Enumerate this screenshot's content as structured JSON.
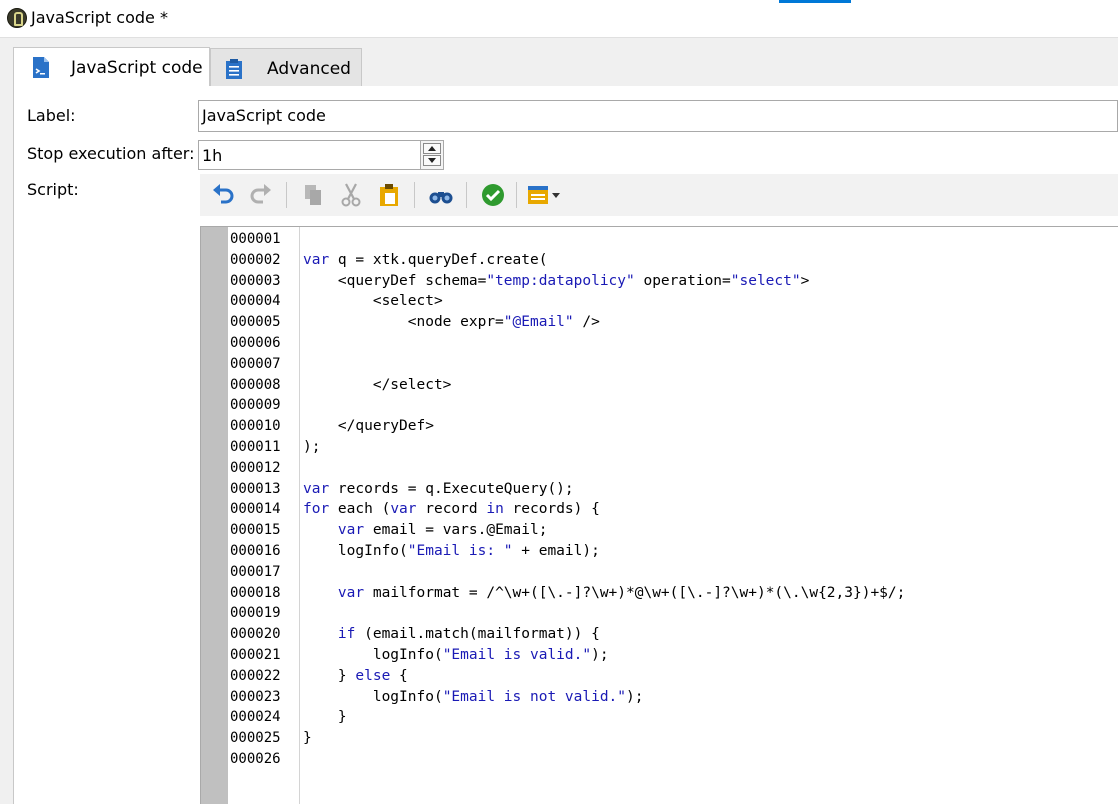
{
  "window": {
    "title": "JavaScript code *"
  },
  "tabs": [
    {
      "label": "JavaScript code",
      "icon": "script-file-icon",
      "active": true
    },
    {
      "label": "Advanced",
      "icon": "clipboard-list-icon",
      "active": false
    }
  ],
  "form": {
    "label_caption": "Label:",
    "label_value": "JavaScript code",
    "stop_caption": "Stop execution after:",
    "stop_value": "1h",
    "script_caption": "Script:"
  },
  "toolbar": [
    "undo-icon",
    "redo-icon",
    "copy-icon",
    "cut-icon",
    "paste-icon",
    "find-icon",
    "validate-icon",
    "insert-menu-icon"
  ],
  "colors": {
    "accent": "#0078d7",
    "keyword": "#1a1ab5",
    "gutter": "#c0c0c0"
  },
  "code_lines": [
    {
      "num": "000001",
      "text": ""
    },
    {
      "num": "000002",
      "text": "var q = xtk.queryDef.create("
    },
    {
      "num": "000003",
      "text": "    <queryDef schema=\"temp:datapolicy\" operation=\"select\">"
    },
    {
      "num": "000004",
      "text": "        <select>"
    },
    {
      "num": "000005",
      "text": "            <node expr=\"@Email\" />"
    },
    {
      "num": "000006",
      "text": ""
    },
    {
      "num": "000007",
      "text": ""
    },
    {
      "num": "000008",
      "text": "        </select>"
    },
    {
      "num": "000009",
      "text": ""
    },
    {
      "num": "000010",
      "text": "    </queryDef>"
    },
    {
      "num": "000011",
      "text": ");"
    },
    {
      "num": "000012",
      "text": ""
    },
    {
      "num": "000013",
      "text": "var records = q.ExecuteQuery();"
    },
    {
      "num": "000014",
      "text": "for each (var record in records) {"
    },
    {
      "num": "000015",
      "text": "    var email = vars.@Email;"
    },
    {
      "num": "000016",
      "text": "    logInfo(\"Email is: \" + email);"
    },
    {
      "num": "000017",
      "text": ""
    },
    {
      "num": "000018",
      "text": "    var mailformat = /^\\w+([\\.-]?\\w+)*@\\w+([\\.-]?\\w+)*(\\.\\w{2,3})+$/;"
    },
    {
      "num": "000019",
      "text": ""
    },
    {
      "num": "000020",
      "text": "    if (email.match(mailformat)) {"
    },
    {
      "num": "000021",
      "text": "        logInfo(\"Email is valid.\");"
    },
    {
      "num": "000022",
      "text": "    } else {"
    },
    {
      "num": "000023",
      "text": "        logInfo(\"Email is not valid.\");"
    },
    {
      "num": "000024",
      "text": "    }"
    },
    {
      "num": "000025",
      "text": "}"
    },
    {
      "num": "000026",
      "text": ""
    }
  ]
}
